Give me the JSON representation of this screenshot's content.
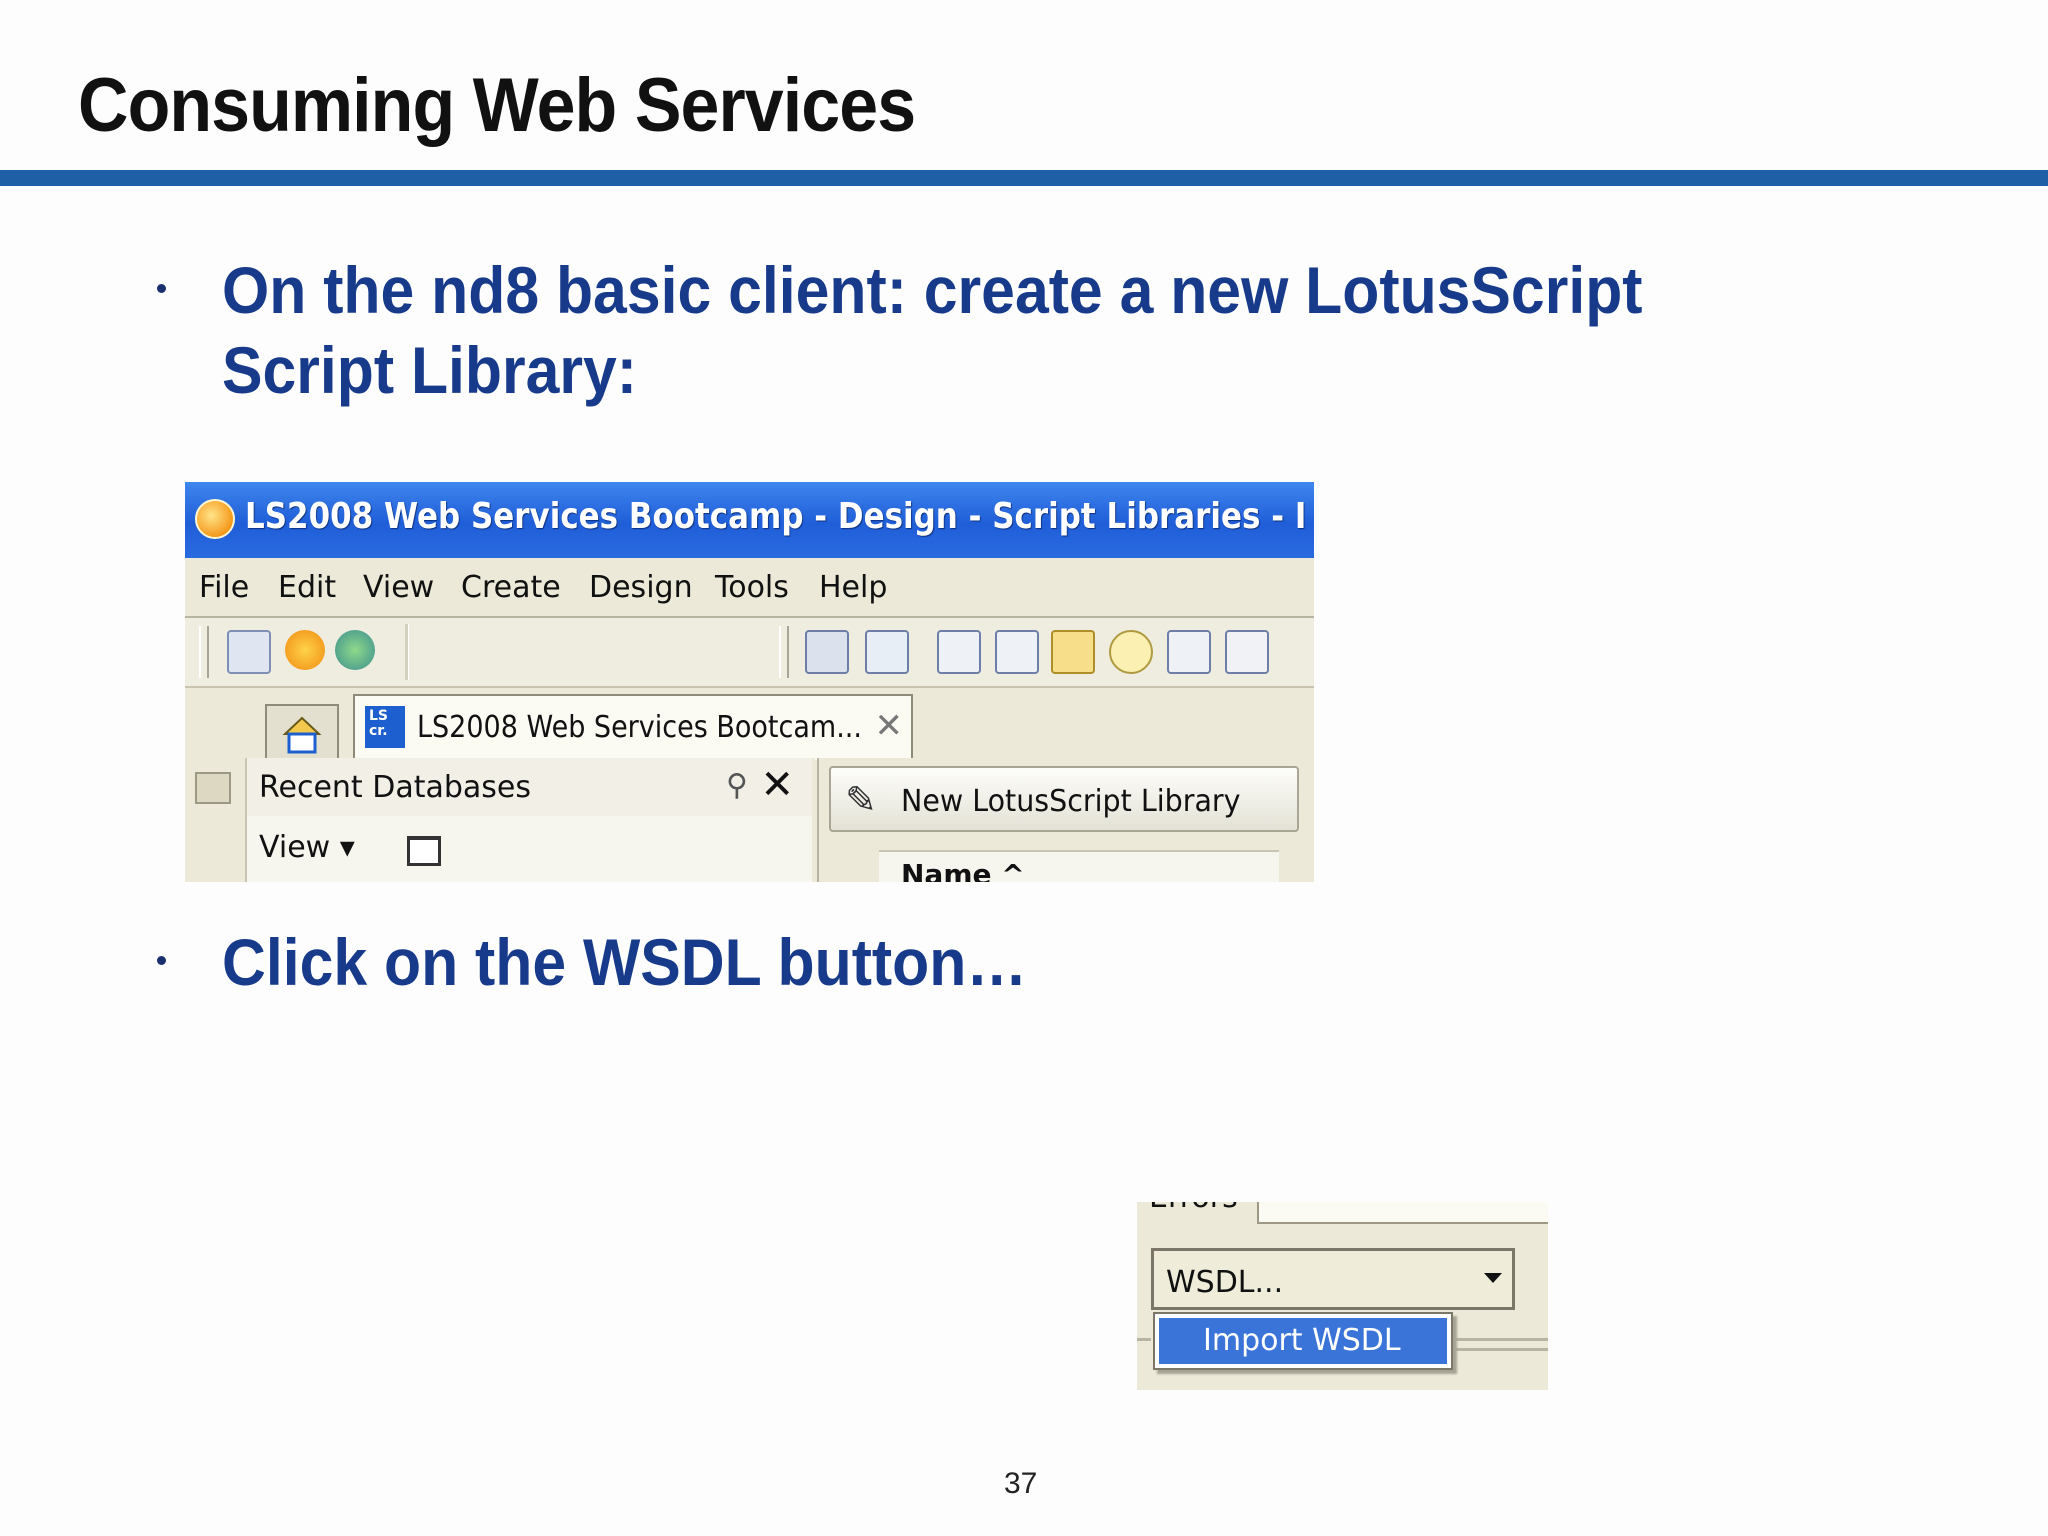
{
  "slide": {
    "title": "Consuming Web Services",
    "bullets": [
      "On the nd8 basic client: create a new LotusScript Script Library:",
      "Click on the WSDL button…"
    ],
    "page_number": "37"
  },
  "screenshot1": {
    "window_title": "LS2008 Web Services Bootcamp - Design - Script Libraries - I",
    "menu": [
      "File",
      "Edit",
      "View",
      "Create",
      "Design",
      "Tools",
      "Help"
    ],
    "tab_label": "LS2008 Web Services Bootcam...",
    "tab_icon_text": "LS cr.",
    "pane_title": "Recent Databases",
    "view_label": "View ▾",
    "new_library_button": "New LotusScript Library",
    "column_header": "Name ^"
  },
  "screenshot2": {
    "errors_label": "Errors",
    "combo_value": "WSDL...",
    "dropdown_option": "Import WSDL"
  },
  "colors": {
    "title_rule": "#1f5fa6",
    "bullet_text": "#173a8a",
    "xp_titlebar": "#2a6ae0",
    "selection": "#3a74d8"
  }
}
